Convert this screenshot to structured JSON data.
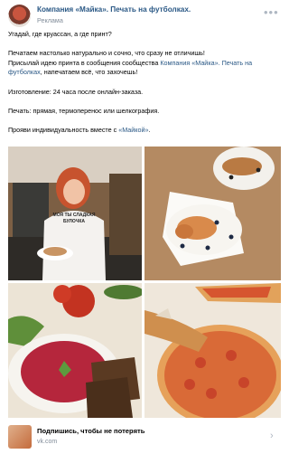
{
  "header": {
    "author": "Компания «Майка». Печать на футболках.",
    "ad_label": "Реклама",
    "more_icon": "more-horizontal-icon"
  },
  "post": {
    "line1": "Угадай, где круассан, а где принт?",
    "line2": "Печатаем настолько натурально и сочно, что сразу не отличишь!",
    "line3_prefix": "Присылай идею принта в сообщения сообщества ",
    "line3_link": "Компания «Майка». Печать на футболках",
    "line3_suffix": ", напечатаем всё, что захочешь!",
    "line4": "Изготовление: 24 часа после онлайн-заказа.",
    "line5": "Печать: прямая, термоперенос или шелкография.",
    "line6_prefix": "Прояви индивидуальность вместе с ",
    "line6_link": "«Майкой»",
    "line6_suffix": "."
  },
  "photos": {
    "tshirt_print_line1": "МОЯ ТЫ СЛАДКАЯ",
    "tshirt_print_line2": "БУЛОЧКА"
  },
  "footer": {
    "title": "Подпишись, чтобы не потерять",
    "url": "vk.com",
    "chevron_icon": "chevron-right-icon"
  },
  "colors": {
    "link": "#2a5885",
    "secondary": "#818c99"
  }
}
